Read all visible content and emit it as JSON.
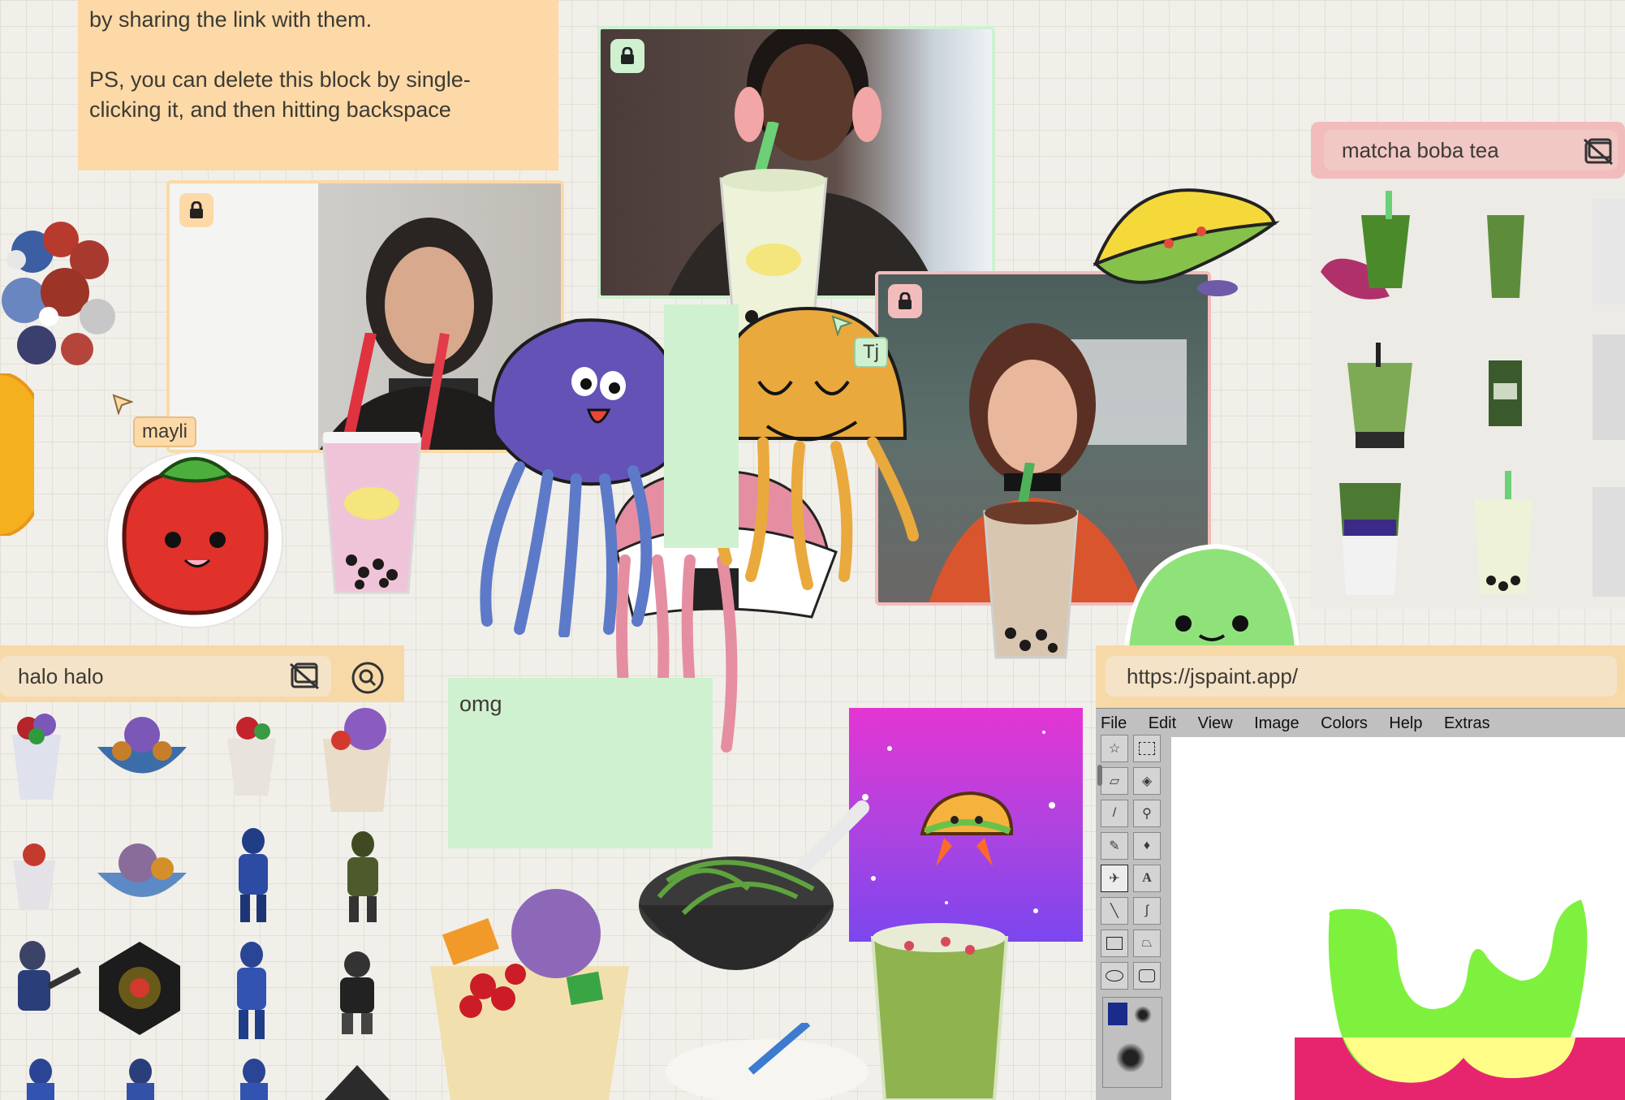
{
  "welcome_note": {
    "lines": "by sharing the link with them.\n\nPS, you can delete this block by single-\nclicking it, and then hitting backspace",
    "color": "#fcd9a6"
  },
  "omg_note": {
    "text": "omg",
    "color": "#cff1d0"
  },
  "cursors": [
    {
      "name": "mayli",
      "color": "#fcd9a6"
    },
    {
      "name": "Tj",
      "color": "#cff1d0"
    }
  ],
  "halo_search": {
    "query": "halo halo",
    "color": "#f7d9a8"
  },
  "matcha_search": {
    "query": "matcha boba tea",
    "color": "#f3bcbc"
  },
  "browser": {
    "url": "https://jspaint.app/",
    "color": "#f7d9a8"
  },
  "jspaint": {
    "menu": [
      "File",
      "Edit",
      "View",
      "Image",
      "Colors",
      "Help",
      "Extras"
    ]
  },
  "icons": {
    "lock": "lock-icon",
    "hide_images": "image-off-icon",
    "search": "search-icon"
  },
  "colors": {
    "lock_orange": "#fcd9a6",
    "lock_green": "#cff1d0",
    "lock_pink": "#f3bcbc"
  }
}
